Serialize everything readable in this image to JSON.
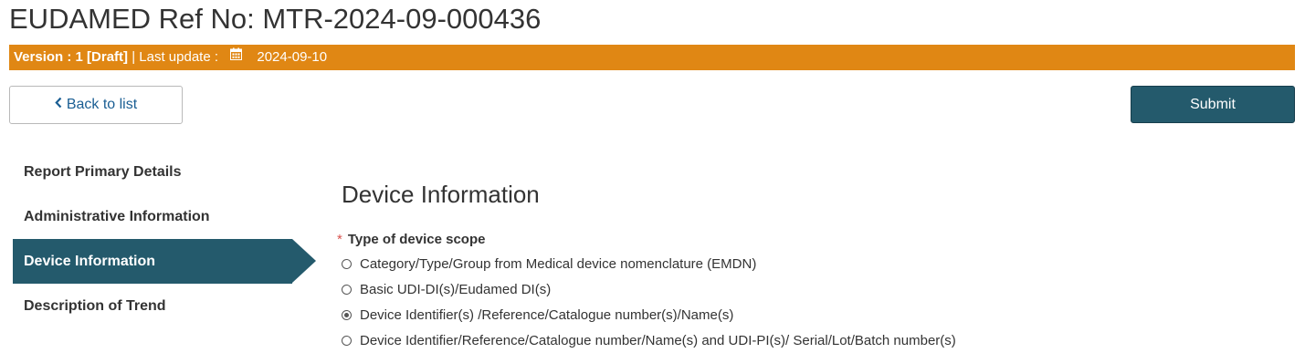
{
  "header": {
    "title": "EUDAMED Ref No: MTR-2024-09-000436"
  },
  "version_bar": {
    "version": "Version : 1 [Draft]",
    "separator": "|",
    "last_update_label": "Last update :",
    "calendar_icon": "calendar-icon",
    "date": "2024-09-10",
    "color": "#e08714"
  },
  "actions": {
    "back_icon": "chevron-left-icon",
    "back_label": "Back to list",
    "submit_label": "Submit"
  },
  "sidebar": {
    "items": [
      {
        "label": "Report Primary Details",
        "active": false
      },
      {
        "label": "Administrative Information",
        "active": false
      },
      {
        "label": "Device Information",
        "active": true
      },
      {
        "label": "Description of Trend",
        "active": false
      }
    ]
  },
  "main": {
    "section_title": "Device Information",
    "field": {
      "required_marker": "*",
      "label": "Type of device scope",
      "options": [
        {
          "label": "Category/Type/Group from Medical device nomenclature (EMDN)",
          "selected": false
        },
        {
          "label": "Basic UDI-DI(s)/Eudamed DI(s)",
          "selected": false
        },
        {
          "label": "Device Identifier(s) /Reference/Catalogue number(s)/Name(s)",
          "selected": true
        },
        {
          "label": "Device Identifier/Reference/Catalogue number/Name(s) and UDI-PI(s)/ Serial/Lot/Batch number(s)",
          "selected": false
        }
      ]
    }
  },
  "colors": {
    "accent": "#245a6c",
    "link": "#1a5e93",
    "required": "#d9534f"
  }
}
